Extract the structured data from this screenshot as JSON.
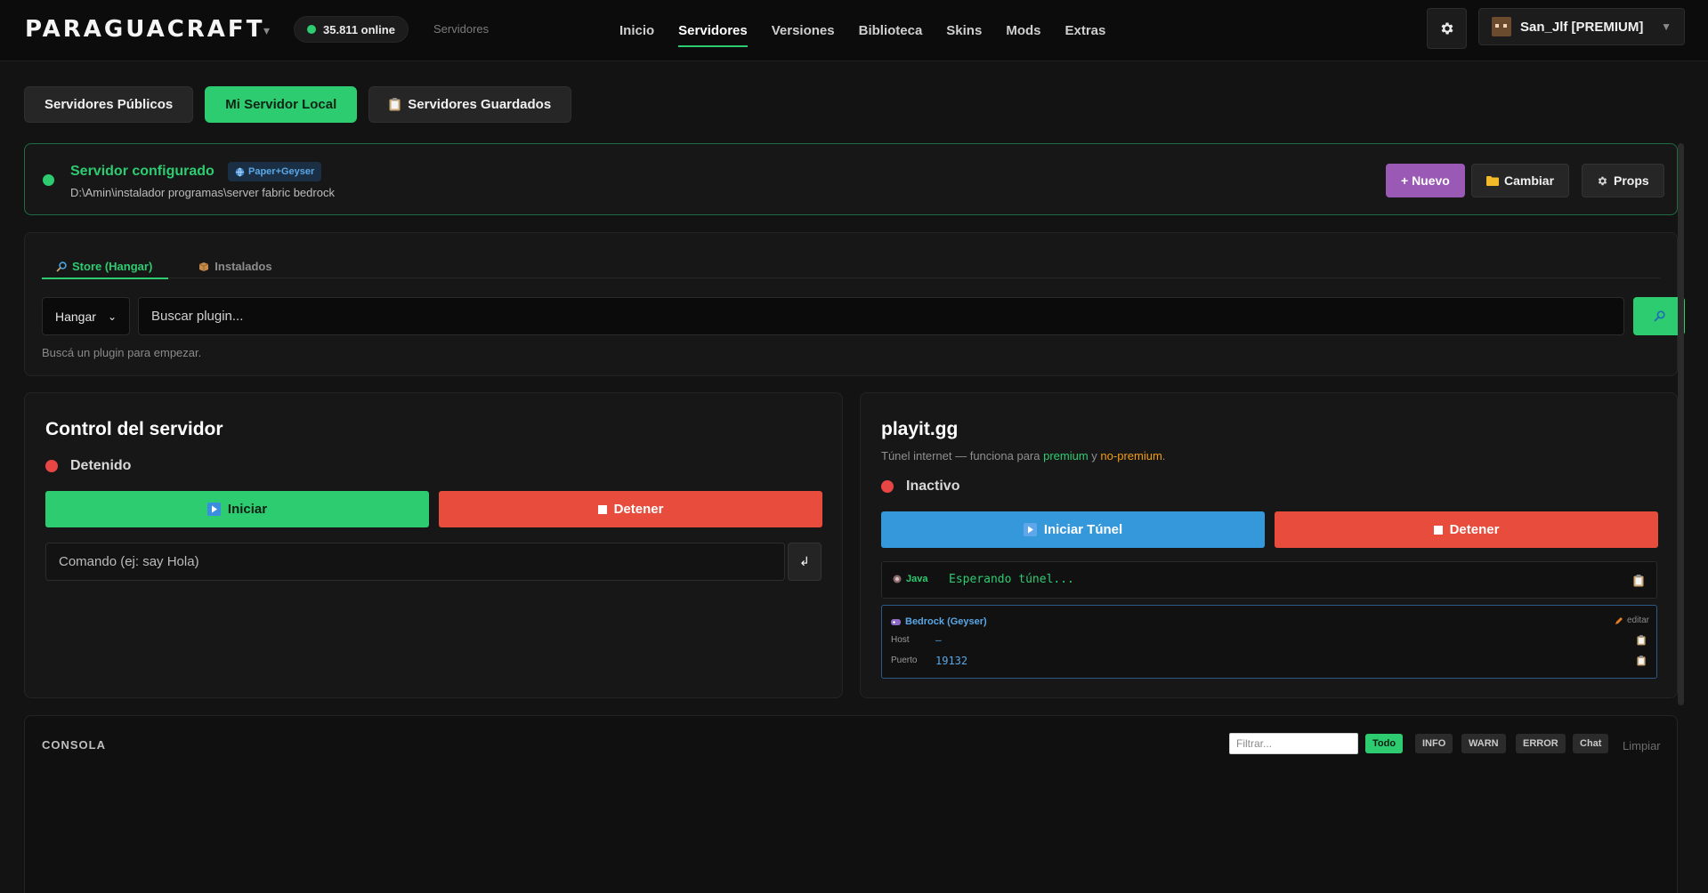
{
  "header": {
    "brand": "PARAGUACRAFT",
    "brand_caret": "▾",
    "online_count": "35.811 online",
    "breadcrumb": "Servidores",
    "nav": [
      "Inicio",
      "Servidores",
      "Versiones",
      "Biblioteca",
      "Skins",
      "Mods",
      "Extras"
    ],
    "active_nav": "Servidores",
    "user_name": "San_Jlf [PREMIUM]"
  },
  "tabs": {
    "public": "Servidores Públicos",
    "local": "Mi Servidor Local",
    "saved": "Servidores Guardados"
  },
  "config": {
    "title": "Servidor configurado",
    "badge": "Paper+Geyser",
    "path": "D:\\Amin\\instalador programas\\server fabric bedrock",
    "new_label": "+ Nuevo",
    "change_label": "Cambiar",
    "props_label": "Props"
  },
  "store": {
    "tab_store": "Store (Hangar)",
    "tab_installed": "Instalados",
    "source": "Hangar",
    "search_placeholder": "Buscar plugin...",
    "hint": "Buscá un plugin para empezar."
  },
  "control": {
    "title": "Control del servidor",
    "status": "Detenido",
    "start_label": "Iniciar",
    "stop_label": "Detener",
    "cmd_placeholder": "Comando (ej: say Hola)",
    "send_icon": "↲"
  },
  "playit": {
    "title": "playit.gg",
    "subtitle_prefix": "Túnel internet — funciona para ",
    "subtitle_premium": "premium",
    "subtitle_and": " y ",
    "subtitle_nopremium": "no-premium",
    "subtitle_dot": ".",
    "status": "Inactivo",
    "start_label": "Iniciar Túnel",
    "stop_label": "Detener",
    "java_label": "Java",
    "java_status": "Esperando túnel...",
    "bedrock_label": "Bedrock (Geyser)",
    "edit_label": "editar",
    "host_label": "Host",
    "host_value": "–",
    "port_label": "Puerto",
    "port_value": "19132"
  },
  "console": {
    "title": "CONSOLA",
    "filter_placeholder": "Filtrar...",
    "levels": [
      "Todo",
      "INFO",
      "WARN",
      "ERROR",
      "Chat"
    ],
    "clear_label": "Limpiar"
  },
  "colors": {
    "accent_green": "#2ecc71",
    "danger_red": "#e74c3c",
    "info_blue": "#3498db",
    "purple": "#9b59b6",
    "warning_orange": "#f39c12"
  }
}
